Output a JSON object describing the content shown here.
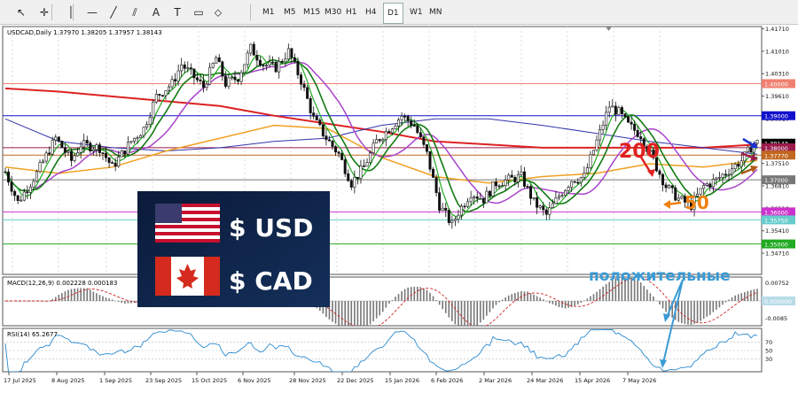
{
  "toolbar": {
    "tools": [
      "cursor-icon",
      "crosshair-icon",
      "vertical-line-icon",
      "horizontal-line-icon",
      "trendline-icon",
      "channel-icon",
      "text-icon",
      "label-icon",
      "rectangle-icon",
      "shapes-icon"
    ],
    "timeframes": [
      "M1",
      "M5",
      "M15",
      "M30",
      "H1",
      "H4",
      "D1",
      "W1",
      "MN"
    ],
    "active_timeframe": "D1"
  },
  "main": {
    "header": "USDCAD,Daily  1.37970 1.38205 1.37957 1.38143",
    "ylim": [
      1.3405,
      1.4178
    ],
    "axis_ticks": [
      "1.41710",
      "1.41010",
      "1.40310",
      "1.39610",
      "1.38910",
      "1.38210",
      "1.37510",
      "1.36810",
      "1.36110",
      "1.35410",
      "1.34710"
    ],
    "level_labels": [
      {
        "value": 1.4,
        "text": "1.40000",
        "bg": "#f08070"
      },
      {
        "value": 1.39,
        "text": "1.39000",
        "bg": "#1111cc"
      },
      {
        "value": 1.38143,
        "text": "1.38143",
        "bg": "#000000"
      },
      {
        "value": 1.38,
        "text": "1.38000",
        "bg": "#9b1b4b"
      },
      {
        "value": 1.3777,
        "text": "1.37770",
        "bg": "#c26820"
      },
      {
        "value": 1.37,
        "text": "1.37000",
        "bg": "#777777"
      },
      {
        "value": 1.36,
        "text": "1.36000",
        "bg": "#cc33cc"
      },
      {
        "value": 1.3575,
        "text": "1.35750",
        "bg": "#66cccc"
      },
      {
        "value": 1.35,
        "text": "1.35000",
        "bg": "#22aa22"
      }
    ],
    "annotations": {
      "ma200": "200",
      "ma50": "50",
      "positive": "положительные"
    },
    "badge": {
      "usd": "$ USD",
      "cad": "$ CAD"
    }
  },
  "macd": {
    "header": "MACD(12,26,9) 0.002228 0.000183",
    "ticks": [
      "0.00752",
      "0.00000",
      "-0.0085"
    ]
  },
  "rsi": {
    "header": "RSI(14) 65.2677",
    "ticks": [
      "70",
      "50",
      "30"
    ]
  },
  "x_labels": [
    "17 Jul 2025",
    "8 Aug 2025",
    "1 Sep 2025",
    "23 Sep 2025",
    "15 Oct 2025",
    "6 Nov 2025",
    "28 Nov 2025",
    "22 Dec 2025",
    "15 Jan 2026",
    "6 Feb 2026",
    "2 Mar 2026",
    "24 Mar 2026",
    "15 Apr 2026",
    "7 May 2026"
  ],
  "colors": {
    "ma200": "#dd2222",
    "ma100": "#3333aa",
    "ma50": "#f0a020",
    "ma_fast": "#22aa22",
    "ma_purple": "#aa44cc",
    "bull": "#111111",
    "bear": "#111111"
  },
  "chart_data": {
    "type": "candlestick",
    "symbol": "USDCAD",
    "timeframe": "Daily",
    "y_range": [
      1.3405,
      1.4178
    ],
    "trend_path": [
      [
        0,
        1.3725
      ],
      [
        4,
        1.363
      ],
      [
        10,
        1.372
      ],
      [
        16,
        1.383
      ],
      [
        21,
        1.376
      ],
      [
        24,
        1.381
      ],
      [
        30,
        1.38
      ],
      [
        34,
        1.374
      ],
      [
        40,
        1.382
      ],
      [
        44,
        1.386
      ],
      [
        48,
        1.396
      ],
      [
        53,
        1.4
      ],
      [
        56,
        1.406
      ],
      [
        60,
        1.402
      ],
      [
        63,
        1.399
      ],
      [
        67,
        1.408
      ],
      [
        70,
        1.4
      ],
      [
        74,
        1.402
      ],
      [
        78,
        1.411
      ],
      [
        82,
        1.406
      ],
      [
        86,
        1.405
      ],
      [
        90,
        1.41
      ],
      [
        94,
        1.401
      ],
      [
        98,
        1.389
      ],
      [
        102,
        1.383
      ],
      [
        106,
        1.378
      ],
      [
        110,
        1.369
      ],
      [
        114,
        1.374
      ],
      [
        118,
        1.382
      ],
      [
        122,
        1.386
      ],
      [
        126,
        1.39
      ],
      [
        130,
        1.387
      ],
      [
        134,
        1.378
      ],
      [
        138,
        1.362
      ],
      [
        142,
        1.356
      ],
      [
        144,
        1.36
      ],
      [
        148,
        1.366
      ],
      [
        152,
        1.364
      ],
      [
        156,
        1.369
      ],
      [
        160,
        1.37
      ],
      [
        164,
        1.371
      ],
      [
        168,
        1.363
      ],
      [
        172,
        1.359
      ],
      [
        176,
        1.365
      ],
      [
        180,
        1.37
      ],
      [
        184,
        1.371
      ],
      [
        188,
        1.382
      ],
      [
        192,
        1.393
      ],
      [
        195,
        1.391
      ],
      [
        198,
        1.387
      ],
      [
        202,
        1.384
      ],
      [
        206,
        1.376
      ],
      [
        210,
        1.368
      ],
      [
        214,
        1.364
      ],
      [
        218,
        1.362
      ],
      [
        222,
        1.368
      ],
      [
        226,
        1.37
      ],
      [
        230,
        1.373
      ],
      [
        234,
        1.376
      ],
      [
        238,
        1.3815
      ]
    ],
    "ma200": [
      1.3985,
      1.3975,
      1.396,
      1.3945,
      1.393,
      1.39,
      1.3875,
      1.385,
      1.382,
      1.381,
      1.38,
      1.38,
      1.38,
      1.38,
      1.381
    ],
    "ma100": [
      1.389,
      1.382,
      1.38,
      1.379,
      1.38,
      1.382,
      1.383,
      1.387,
      1.389,
      1.389,
      1.387,
      1.3845,
      1.382,
      1.38,
      1.378
    ],
    "ma50": [
      1.374,
      1.372,
      1.374,
      1.379,
      1.383,
      1.387,
      1.386,
      1.377,
      1.371,
      1.369,
      1.371,
      1.372,
      1.375,
      1.374,
      1.376
    ],
    "last_price": 1.38143
  }
}
